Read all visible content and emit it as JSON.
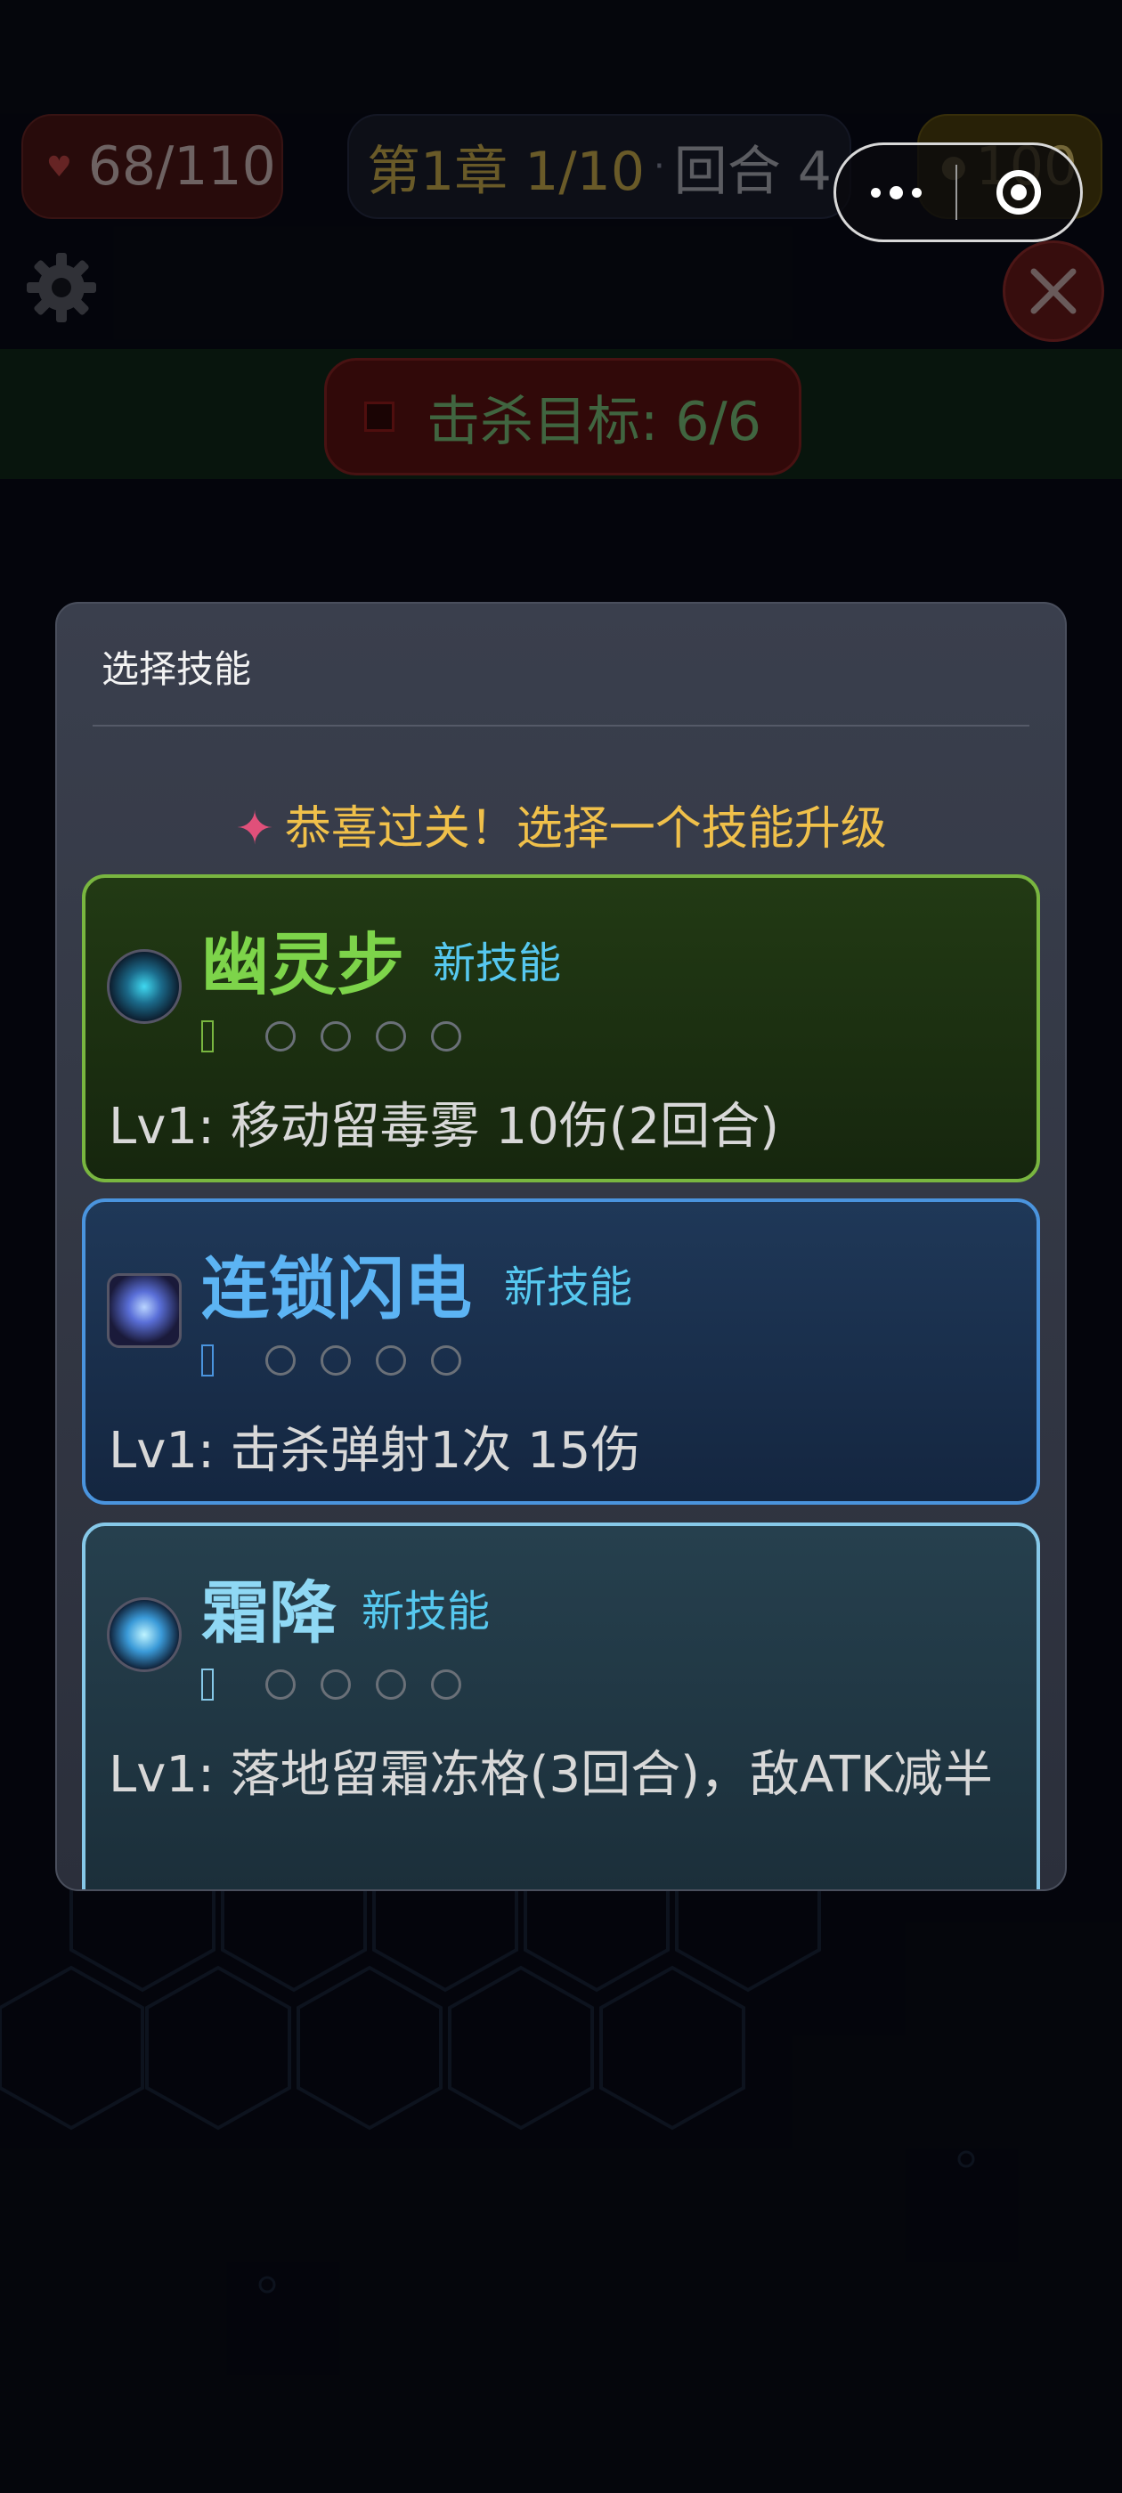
{
  "hud": {
    "hp": "68/110",
    "chapter": "第1章 1/10",
    "separator": "·",
    "round": "回合 4",
    "gold": "100",
    "kill_target": "击杀目标: 6/6"
  },
  "capsule": {
    "more_icon": "more-dots-icon",
    "home_icon": "target-circle-icon"
  },
  "modal": {
    "title": "选择技能",
    "congrats": "恭喜过关！选择一个技能升级",
    "skills": [
      {
        "name": "幽灵步",
        "badge": "新技能",
        "level": 1,
        "max_level": 5,
        "desc": "Lv1: 移动留毒雾 10伤(2回合)",
        "color": "#7dd44a"
      },
      {
        "name": "连锁闪电",
        "badge": "新技能",
        "level": 1,
        "max_level": 5,
        "desc": "Lv1: 击杀弹射1次 15伤",
        "color": "#5cb4f4"
      },
      {
        "name": "霜降",
        "badge": "新技能",
        "level": 1,
        "max_level": 5,
        "desc": "Lv1: 落地留霜冻格(3回合)，敌ATK减半",
        "color": "#8fd8f4"
      }
    ]
  }
}
